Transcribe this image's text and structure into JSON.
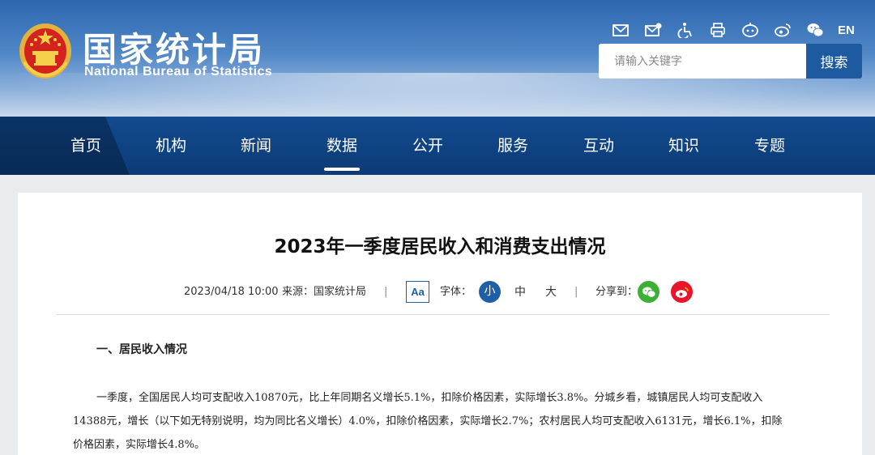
{
  "site": {
    "name_cn": "国家统计局",
    "name_en": "National Bureau of Statistics"
  },
  "toolbar": {
    "icons": [
      "mail-icon",
      "mail-settings-icon",
      "accessibility-icon",
      "printer-icon",
      "robot-icon",
      "weibo-icon",
      "wechat-icon"
    ],
    "lang_label": "EN"
  },
  "search": {
    "placeholder": "请输入关键字",
    "button_label": "搜索"
  },
  "nav": {
    "items": [
      "首页",
      "机构",
      "新闻",
      "数据",
      "公开",
      "服务",
      "互动",
      "知识",
      "专题"
    ],
    "active": "数据"
  },
  "article": {
    "title": "2023年一季度居民收入和消费支出情况",
    "date": "2023/04/18 10:00",
    "source": "来源：国家统计局",
    "sep": "|",
    "aa_label": "Aa",
    "font_label": "字体：",
    "font_small": "小",
    "font_medium": "中",
    "font_large": "大",
    "share_label": "分享到：",
    "section_heading": "一、居民收入情况",
    "para_lines": [
      "一季度，全国居民人均可支配收入10870元，比上年同期名义增长5.1%，扣除价格因素，实际增长3.8%。分城乡看，城镇居民人均可支配收入",
      "14388元，增长（以下如无特别说明，均为同比名义增长）4.0%，扣除价格因素，实际增长2.7%；农村居民人均可支配收入6131元，增长6.1%，扣除",
      "价格因素，实际增长4.8%。"
    ]
  },
  "colors": {
    "nav_bg": "#0c3b76",
    "accent": "#1f5fa6",
    "wechat": "#3cb034",
    "weibo": "#e6162d"
  }
}
